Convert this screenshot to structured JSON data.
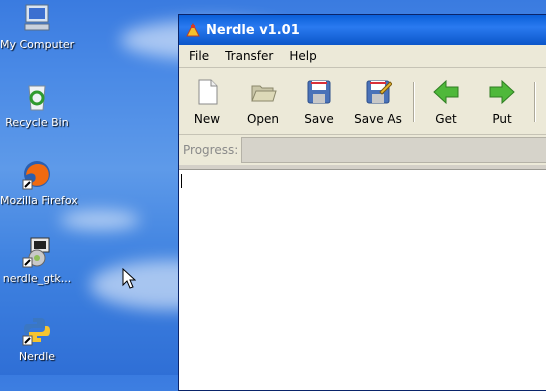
{
  "desktop": {
    "icons": [
      {
        "label": "My Computer",
        "icon": "my-computer-icon"
      },
      {
        "label": "Recycle Bin",
        "icon": "recycle-bin-icon"
      },
      {
        "label": "Mozilla Firefox",
        "icon": "firefox-icon"
      },
      {
        "label": "nerdle_gtk...",
        "icon": "installer-icon"
      },
      {
        "label": "Nerdle",
        "icon": "python-icon"
      }
    ]
  },
  "window": {
    "title": "Nerdle v1.01",
    "menu": {
      "file": "File",
      "transfer": "Transfer",
      "help": "Help"
    },
    "toolbar": {
      "new": "New",
      "open": "Open",
      "save": "Save",
      "save_as": "Save As",
      "get": "Get",
      "put": "Put"
    },
    "progress_label": "Progress:"
  },
  "colors": {
    "titlebar": "#0a5fd8",
    "accent_green": "#3ea82f"
  }
}
